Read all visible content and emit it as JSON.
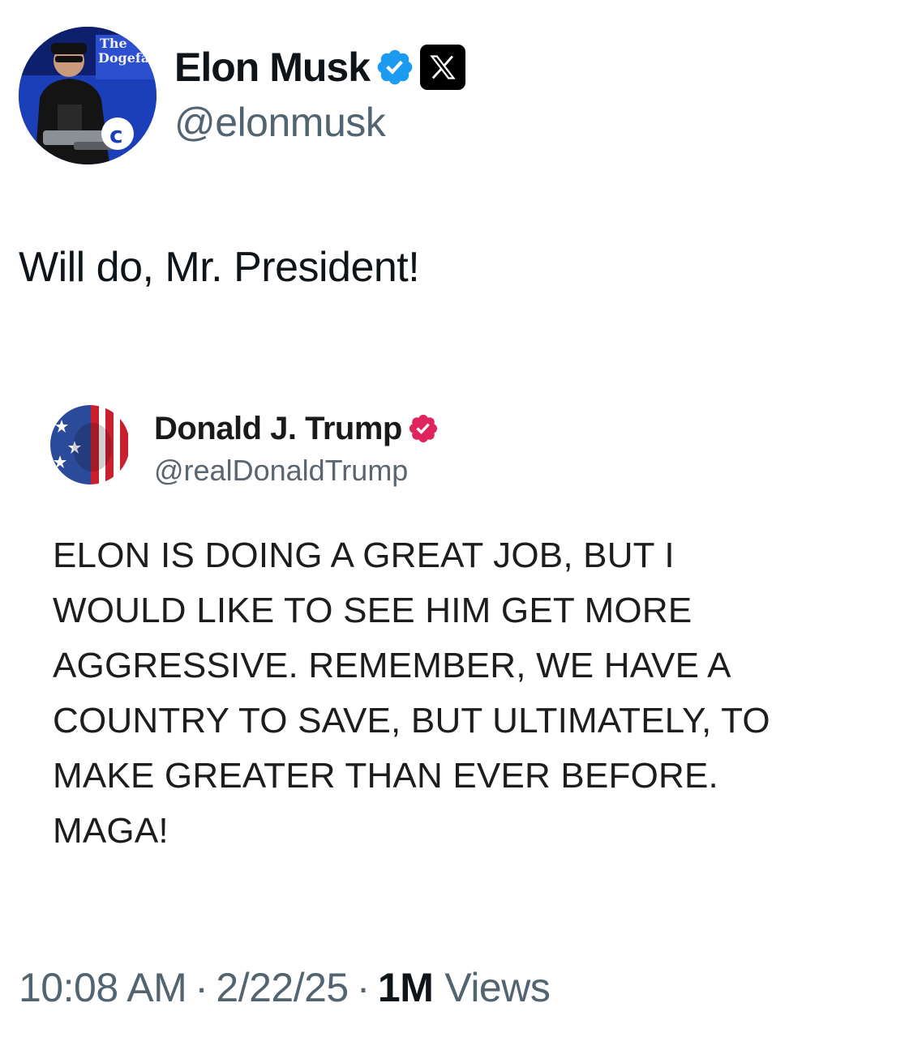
{
  "author": {
    "name": "Elon Musk",
    "handle": "@elonmusk",
    "avatar_text": "The Dogefa",
    "verified_color": "#1d9bf0"
  },
  "tweet": {
    "text": "Will do, Mr. President!"
  },
  "quoted_post": {
    "name": "Donald J. Trump",
    "handle": "@realDonaldTrump",
    "verified_color": "#e0245e",
    "lines": [
      "ELON IS DOING A GREAT JOB, BUT I",
      "WOULD LIKE TO SEE HIM GET MORE",
      "AGGRESSIVE. REMEMBER, WE HAVE A",
      "COUNTRY TO SAVE, BUT ULTIMATELY, TO",
      "MAKE GREATER THAN EVER BEFORE.",
      "MAGA!"
    ]
  },
  "meta": {
    "time": "10:08 AM",
    "separator": "·",
    "date": "2/22/25",
    "views_count": "1M",
    "views_label": "Views"
  },
  "icons": {
    "platform": "x-logo-icon",
    "verified": "verified-badge-icon"
  }
}
